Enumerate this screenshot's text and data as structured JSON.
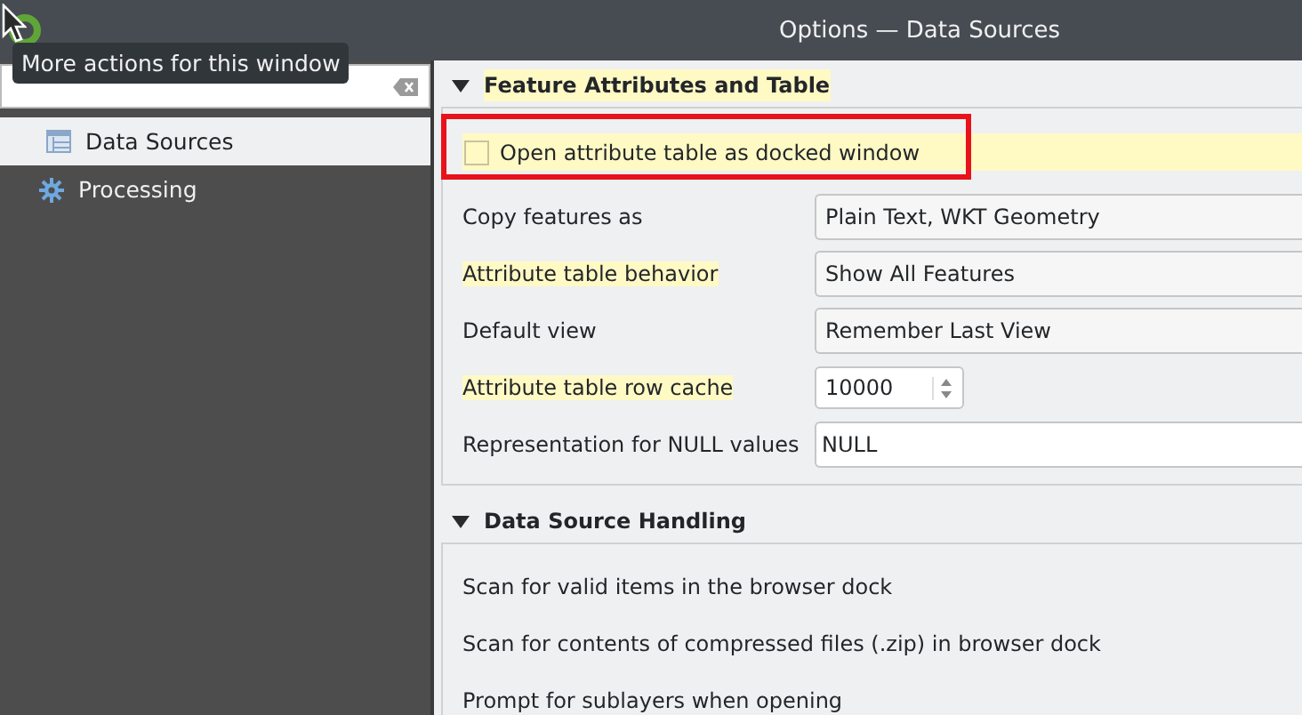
{
  "window": {
    "title": "Options — Data Sources"
  },
  "tooltip": {
    "text": "More actions for this window"
  },
  "sidebar": {
    "items": [
      {
        "label": "Data Sources",
        "selected": true
      },
      {
        "label": "Processing",
        "selected": false
      }
    ]
  },
  "sections": [
    {
      "title": "Feature Attributes and Table",
      "expanded": true,
      "highlighted": true,
      "rows": [
        {
          "kind": "checkbox",
          "label": "Open attribute table as docked window",
          "checked": false,
          "highlighted": true,
          "outlined": true
        },
        {
          "kind": "combo",
          "label": "Copy features as",
          "value": "Plain Text, WKT Geometry",
          "highlighted": false,
          "outlined": false
        },
        {
          "kind": "combo",
          "label": "Attribute table behavior",
          "value": "Show All Features",
          "highlighted": true,
          "outlined": false
        },
        {
          "kind": "combo",
          "label": "Default view",
          "value": "Remember Last View",
          "highlighted": false,
          "outlined": false
        },
        {
          "kind": "spinbox",
          "label": "Attribute table row cache",
          "value": "10000",
          "highlighted": true,
          "outlined": false
        },
        {
          "kind": "text",
          "label": "Representation for NULL values",
          "value": "NULL",
          "highlighted": false,
          "outlined": false
        }
      ]
    },
    {
      "title": "Data Source Handling",
      "expanded": true,
      "highlighted": false,
      "rows": [
        {
          "kind": "plain",
          "label": "Scan for valid items in the browser dock",
          "highlighted": false,
          "outlined": false
        },
        {
          "kind": "plain",
          "label": "Scan for contents of compressed files (.zip) in browser dock",
          "highlighted": false,
          "outlined": false
        },
        {
          "kind": "plain",
          "label": "Prompt for sublayers when opening",
          "highlighted": false,
          "outlined": false
        }
      ]
    }
  ]
}
